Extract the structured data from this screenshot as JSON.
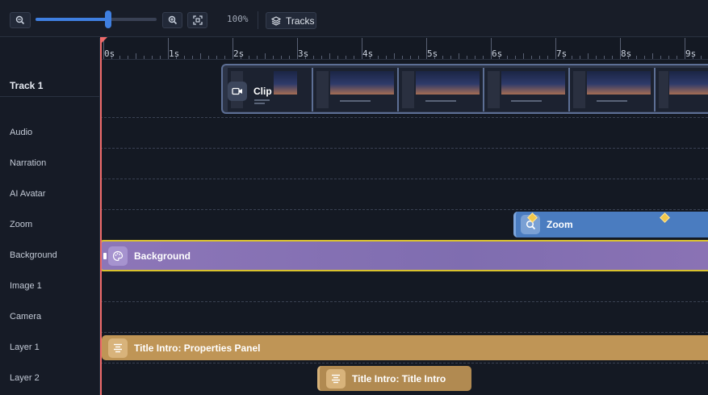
{
  "toolbar": {
    "zoom_out_icon": "zoom-out-icon",
    "zoom_in_icon": "zoom-in-icon",
    "fit_icon": "fit-to-screen-icon",
    "zoom_level": "100%",
    "zoom_slider_value": 0.6,
    "tracks_label": "Tracks",
    "tracks_icon": "layers-icon"
  },
  "ruler": {
    "labels": [
      "0s",
      "1s",
      "2s",
      "3s",
      "4s",
      "5s",
      "6s",
      "7s",
      "8s",
      "9s"
    ]
  },
  "tracks": [
    {
      "name": "Track 1"
    },
    {
      "name": "Audio"
    },
    {
      "name": "Narration"
    },
    {
      "name": "AI Avatar"
    },
    {
      "name": "Zoom"
    },
    {
      "name": "Background"
    },
    {
      "name": "Image 1"
    },
    {
      "name": "Camera"
    },
    {
      "name": "Layer 1"
    },
    {
      "name": "Layer 2"
    }
  ],
  "clips": {
    "video": {
      "label": "Clip",
      "icon": "video-camera-icon"
    },
    "zoom": {
      "label": "Zoom",
      "icon": "magnifier-icon",
      "keyframes": 2
    },
    "background": {
      "label": "Background",
      "icon": "palette-icon"
    },
    "title1": {
      "label": "Title Intro: Properties Panel",
      "icon": "align-center-icon"
    },
    "title2": {
      "label": "Title Intro: Title Intro",
      "icon": "align-center-icon"
    }
  },
  "colors": {
    "accent": "#3f7fe0",
    "playhead": "#f06a6a",
    "zoom_clip": "#4a7cc0",
    "background_clip": "#8d76b8",
    "title_clip": "#bf9556",
    "keyframe": "#f2c84b",
    "selection": "#d9c22e"
  }
}
